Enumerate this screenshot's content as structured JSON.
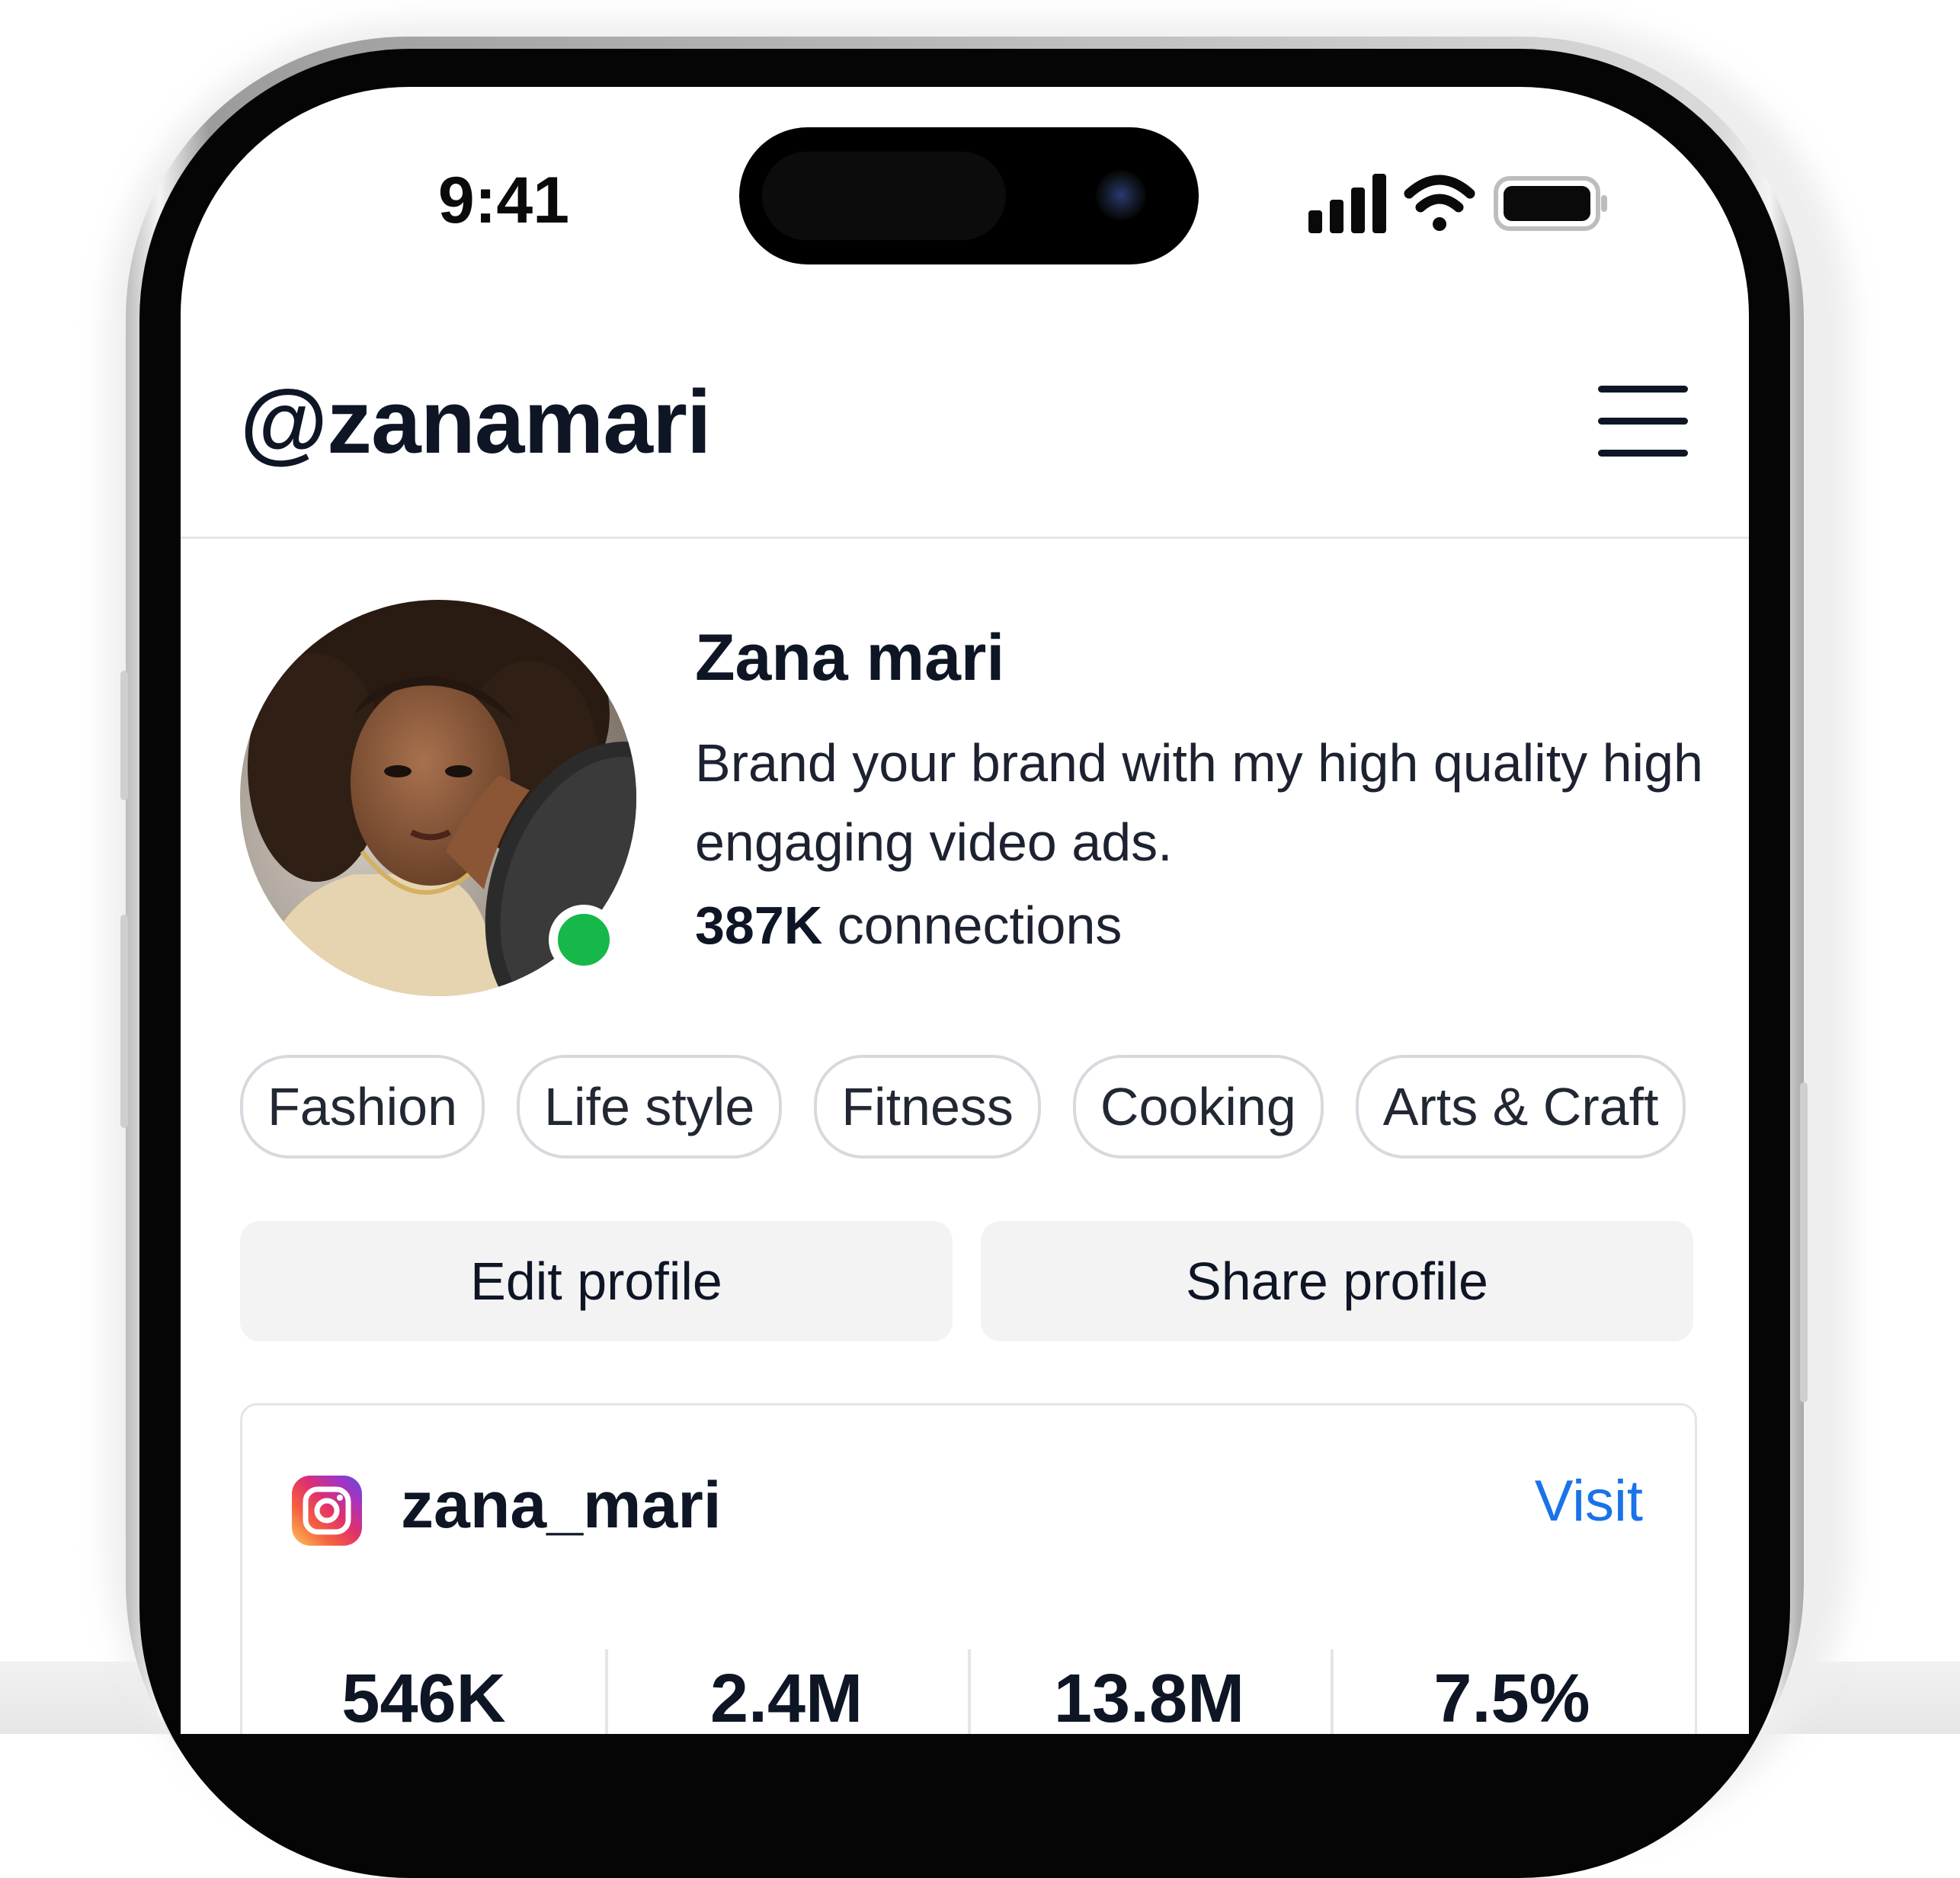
{
  "status_bar": {
    "time": "9:41",
    "icons": [
      "cellular-signal-icon",
      "wifi-icon",
      "battery-icon"
    ]
  },
  "header": {
    "username": "@zanamari",
    "menu_icon": "hamburger-menu-icon"
  },
  "profile": {
    "name": "Zana mari",
    "bio": "Brand your brand with my high quality high engaging video ads.",
    "connections_count": "387K",
    "connections_label": " connections",
    "online_status_color": "#17b84a"
  },
  "tags": [
    "Fashion",
    "Life style",
    "Fitness",
    "Cooking",
    "Arts & Craft"
  ],
  "actions": {
    "edit_label": "Edit profile",
    "share_label": "Share profile"
  },
  "social_card": {
    "platform_icon": "instagram-icon",
    "handle": "zana_mari",
    "visit_label": "Visit",
    "visit_color": "#1a73e8",
    "stats": [
      "546K",
      "2.4M",
      "13.8M",
      "7.5%"
    ]
  }
}
